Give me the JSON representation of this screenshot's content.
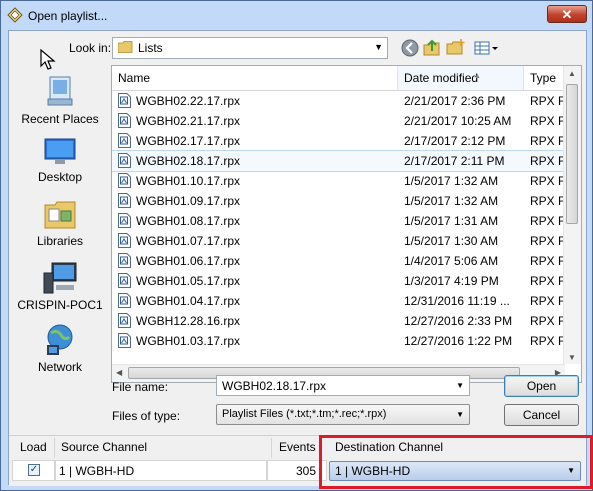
{
  "window": {
    "title": "Open playlist...",
    "close_label": "✕"
  },
  "lookin": {
    "label": "Look in:",
    "value": "Lists"
  },
  "places": [
    {
      "label": "Recent Places",
      "icon": "recent-places-icon"
    },
    {
      "label": "Desktop",
      "icon": "desktop-icon"
    },
    {
      "label": "Libraries",
      "icon": "libraries-icon"
    },
    {
      "label": "CRISPIN-POC1",
      "icon": "computer-icon"
    },
    {
      "label": "Network",
      "icon": "network-icon"
    }
  ],
  "columns": {
    "name": "Name",
    "date": "Date modified",
    "type": "Type"
  },
  "files": [
    {
      "name": "WGBH02.22.17.rpx",
      "date": "2/21/2017 2:36 PM",
      "type": "RPX Fil"
    },
    {
      "name": "WGBH02.21.17.rpx",
      "date": "2/21/2017 10:25 AM",
      "type": "RPX Fil"
    },
    {
      "name": "WGBH02.17.17.rpx",
      "date": "2/17/2017 2:12 PM",
      "type": "RPX Fil"
    },
    {
      "name": "WGBH02.18.17.rpx",
      "date": "2/17/2017 2:11 PM",
      "type": "RPX Fil"
    },
    {
      "name": "WGBH01.10.17.rpx",
      "date": "1/5/2017 1:32 AM",
      "type": "RPX Fil"
    },
    {
      "name": "WGBH01.09.17.rpx",
      "date": "1/5/2017 1:32 AM",
      "type": "RPX Fil"
    },
    {
      "name": "WGBH01.08.17.rpx",
      "date": "1/5/2017 1:31 AM",
      "type": "RPX Fil"
    },
    {
      "name": "WGBH01.07.17.rpx",
      "date": "1/5/2017 1:30 AM",
      "type": "RPX Fil"
    },
    {
      "name": "WGBH01.06.17.rpx",
      "date": "1/4/2017 5:06 AM",
      "type": "RPX Fil"
    },
    {
      "name": "WGBH01.05.17.rpx",
      "date": "1/3/2017 4:19 PM",
      "type": "RPX Fil"
    },
    {
      "name": "WGBH01.04.17.rpx",
      "date": "12/31/2016 11:19 ...",
      "type": "RPX Fil"
    },
    {
      "name": "WGBH12.28.16.rpx",
      "date": "12/27/2016 2:33 PM",
      "type": "RPX Fil"
    },
    {
      "name": "WGBH01.03.17.rpx",
      "date": "12/27/2016 1:22 PM",
      "type": "RPX Fil"
    }
  ],
  "selected_file_index": 3,
  "filename": {
    "label": "File name:",
    "value": "WGBH02.18.17.rpx"
  },
  "filetype": {
    "label": "Files of type:",
    "value": "Playlist Files (*.txt;*.tm;*.rec;*.rpx)"
  },
  "buttons": {
    "open": "Open",
    "cancel": "Cancel"
  },
  "channels": {
    "load_header": "Load",
    "source_header": "Source Channel",
    "events_header": "Events",
    "destination_header": "Destination Channel",
    "load_checked": true,
    "source_value": "1 | WGBH-HD",
    "events_value": "305",
    "destination_value": "1 | WGBH-HD"
  },
  "colors": {
    "highlight": "#dc1c2a",
    "selection": "#f4f9fd"
  }
}
